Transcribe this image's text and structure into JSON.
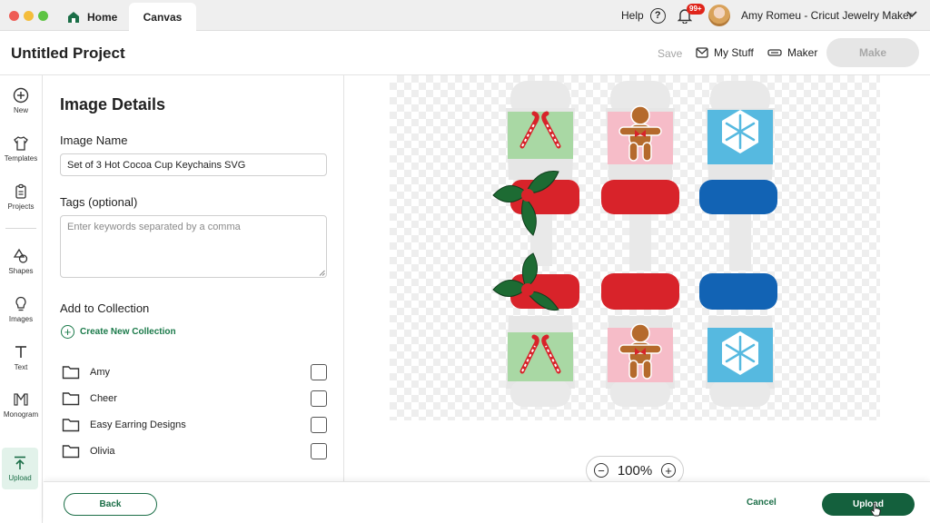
{
  "titlebar": {
    "tab_home": "Home",
    "tab_canvas": "Canvas",
    "help": "Help",
    "help_icon": "?",
    "notification_badge": "99+",
    "user_name": "Amy Romeu - Cricut Jewelry Maker"
  },
  "header": {
    "project_title": "Untitled Project",
    "save": "Save",
    "my_stuff": "My Stuff",
    "maker": "Maker",
    "make": "Make"
  },
  "nav": {
    "items": [
      {
        "label": "New",
        "icon": "plus-circle-icon"
      },
      {
        "label": "Templates",
        "icon": "tshirt-icon"
      },
      {
        "label": "Projects",
        "icon": "clipboard-icon"
      },
      {
        "label": "Shapes",
        "icon": "shapes-icon"
      },
      {
        "label": "Images",
        "icon": "lightbulb-icon"
      },
      {
        "label": "Text",
        "icon": "text-icon"
      },
      {
        "label": "Monogram",
        "icon": "monogram-icon"
      },
      {
        "label": "Upload",
        "icon": "upload-icon"
      }
    ]
  },
  "panel": {
    "title": "Image Details",
    "image_name_label": "Image Name",
    "image_name_value": "Set of 3 Hot Cocoa Cup Keychains SVG",
    "tags_label": "Tags (optional)",
    "tags_placeholder": "Enter keywords separated by a comma",
    "collection_label": "Add to Collection",
    "create_collection": "Create New Collection",
    "collections": [
      "Amy",
      "Cheer",
      "Easy Earring Designs",
      "Olivia"
    ]
  },
  "canvas": {
    "zoom_minus": "−",
    "zoom_level": "100%",
    "zoom_plus": "+"
  },
  "footer": {
    "back": "Back",
    "cancel": "Cancel",
    "upload": "Upload"
  },
  "colors": {
    "brand_green": "#14603d",
    "cup_red": "#d8232a",
    "cup_blue": "#1263b4",
    "sleeve_green": "#a9d8a4",
    "sleeve_pink": "#f6bcc8",
    "sleeve_blue": "#56b9e0"
  }
}
